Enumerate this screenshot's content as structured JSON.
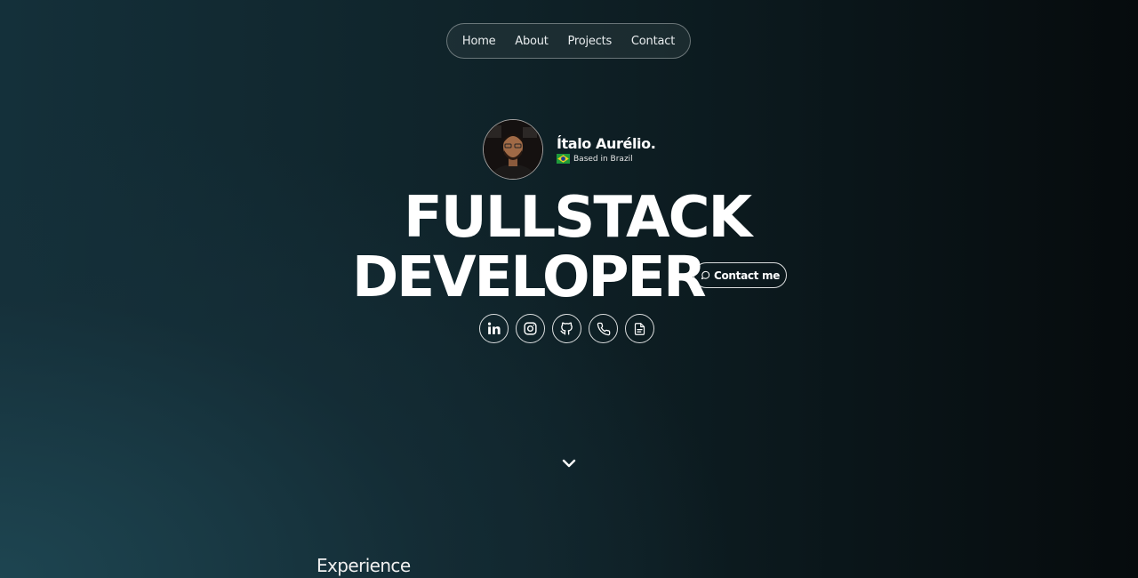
{
  "nav": {
    "items": [
      {
        "label": "Home"
      },
      {
        "label": "About"
      },
      {
        "label": "Projects"
      },
      {
        "label": "Contact"
      }
    ]
  },
  "profile": {
    "name": "Ítalo Aurélio.",
    "location": "Based in Brazil",
    "flag_icon": "brazil-flag-icon"
  },
  "hero": {
    "line1": "FULLSTACK",
    "line2": "DEVELOPER",
    "contact_label": "Contact me",
    "contact_icon": "chat-bubble-icon"
  },
  "socials": [
    {
      "icon": "linkedin-icon"
    },
    {
      "icon": "instagram-icon"
    },
    {
      "icon": "github-icon"
    },
    {
      "icon": "phone-icon"
    },
    {
      "icon": "document-icon"
    }
  ],
  "scroll": {
    "icon": "chevron-down-icon"
  },
  "sections": {
    "experience_heading": "Experience"
  },
  "colors": {
    "text": "#ffffff",
    "background_dark": "#060b0d",
    "background_teal": "#1e4652"
  }
}
